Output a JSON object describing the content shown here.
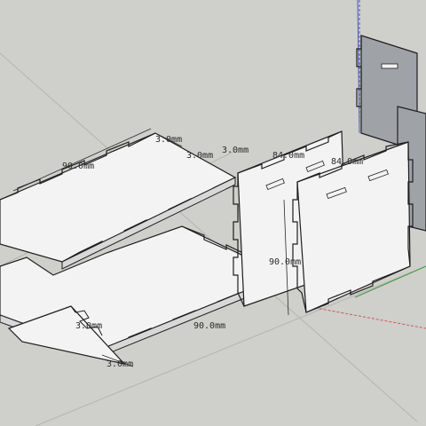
{
  "scene": {
    "background_color": "#cfcfcb",
    "panel_color": "#f3f3f3",
    "shadow_panel_color": "#9fa3a8",
    "edge_color": "#1e1e1e",
    "axis_colors": {
      "red": "#c85a5a",
      "green": "#3c9a3c",
      "blue": "#4a5ab8"
    }
  },
  "dimensions": {
    "top_width": "90.0mm",
    "top_thickness": "3.0mm",
    "top_thickness_b": "3.0mm",
    "mid_thickness": "3.0mm",
    "side_width_a": "84.0mm",
    "side_width_b": "84.0mm",
    "side_height": "90.0mm",
    "bottom_width": "90.0mm",
    "bottom_thickness": "3.0mm",
    "bottom_thickness_b": "3.0mm"
  }
}
